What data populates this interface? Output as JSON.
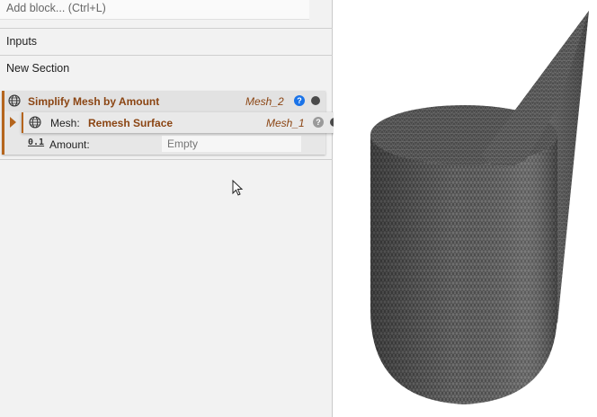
{
  "editor": {
    "add_block_placeholder": "Add block... (Ctrl+L)",
    "sections": [
      "Inputs",
      "New Section"
    ]
  },
  "block": {
    "title": "Simplify Mesh by Amount",
    "output_name": "Mesh_2",
    "help_icon": "question-circle-blue",
    "status_icon": "dark-dot",
    "inputs": {
      "mesh": {
        "label": "Mesh:",
        "value": "Remesh Surface",
        "output_name": "Mesh_1",
        "help_icon": "question-circle-grey",
        "status_icon": "dark-dot"
      },
      "amount": {
        "icon_text": "0.1",
        "label": "Amount:",
        "placeholder": "Empty"
      }
    }
  },
  "viewport": {
    "content": "mesh-preview-3d",
    "mesh_color": "#4a4a4a",
    "wire_color": "#9a9a9a"
  },
  "colors": {
    "accent": "#b5651d",
    "block_title": "#8b4513",
    "help_blue": "#1a73e8"
  }
}
